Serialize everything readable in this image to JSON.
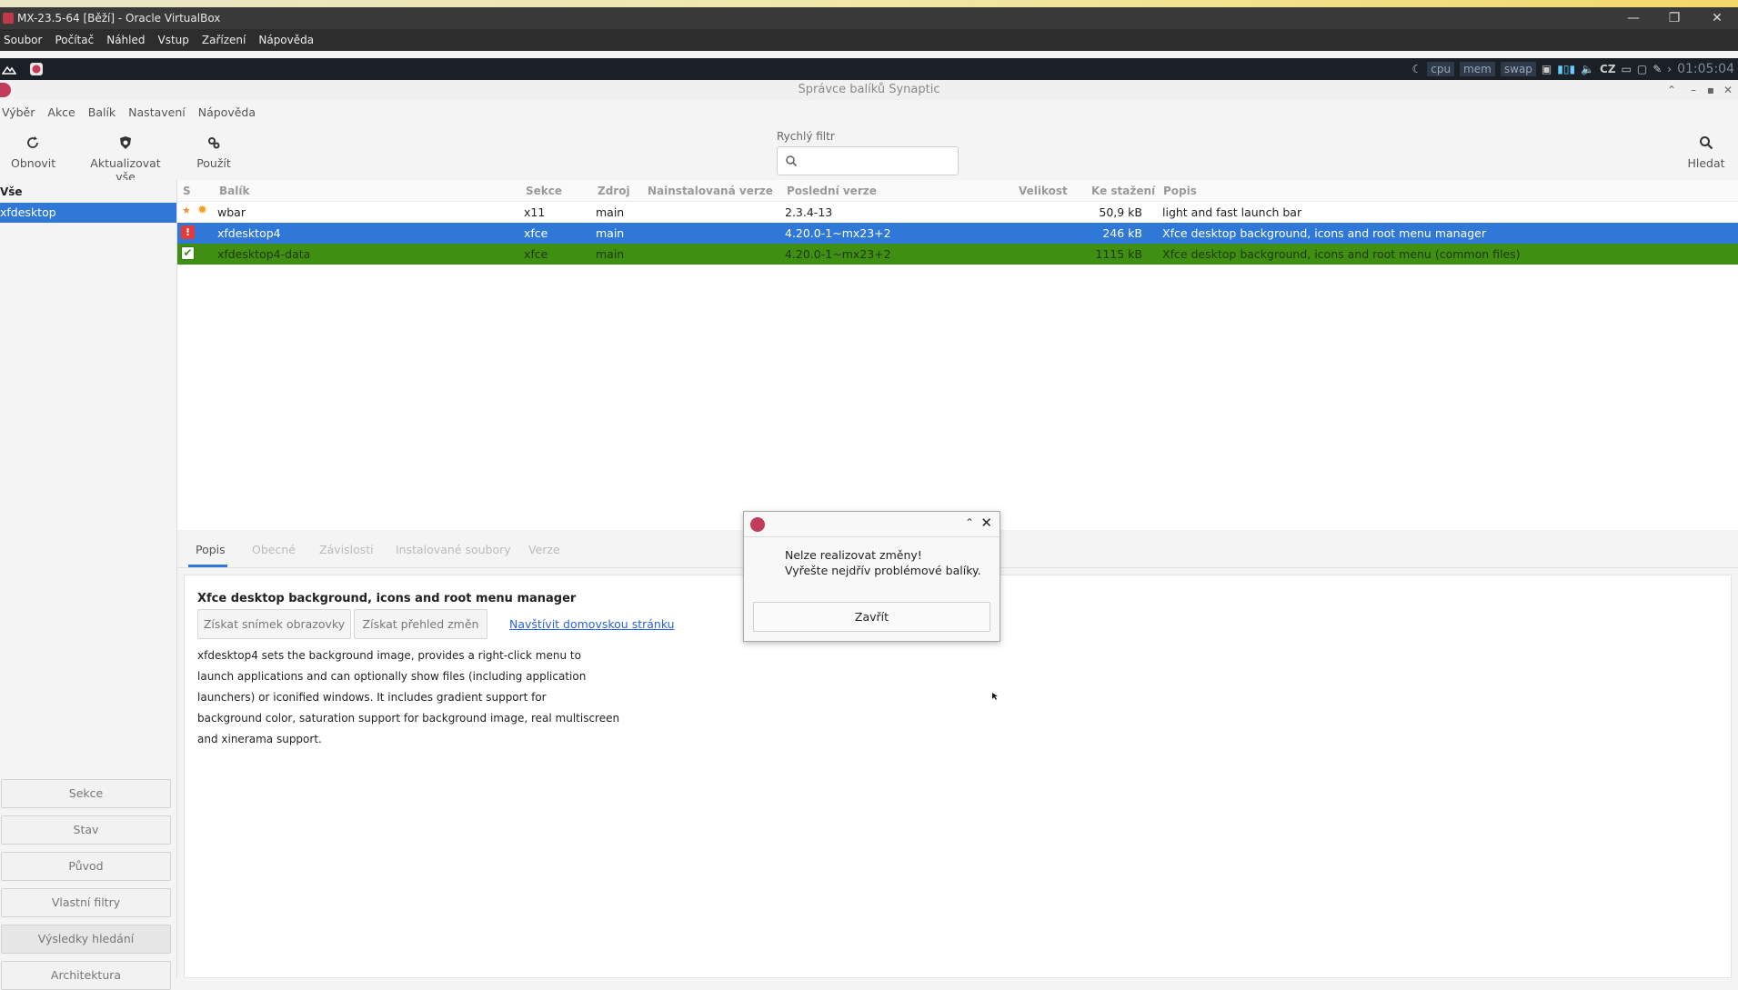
{
  "host": {
    "title": "MX-23.5-64 [Běží] - Oracle VirtualBox",
    "menu": [
      "Soubor",
      "Počítač",
      "Náhled",
      "Vstup",
      "Zařízení",
      "Nápověda"
    ],
    "minimize": "—",
    "maximize": "❐",
    "close": "✕"
  },
  "panel": {
    "cpu": "cpu",
    "mem": "mem",
    "swap": "swap",
    "keyboard": "CZ",
    "clock": "01:05:04"
  },
  "synaptic": {
    "title": "Správce balíků Synaptic",
    "menu": [
      "Výběr",
      "Akce",
      "Balík",
      "Nastavení",
      "Nápověda"
    ],
    "toolbar": {
      "reload": "Obnovit",
      "upgrade_all": "Aktualizovat vše",
      "apply": "Použít",
      "search": "Hledat"
    },
    "quick_filter": {
      "label": "Rychlý filtr",
      "value": ""
    },
    "sidebar": {
      "header": "Vše",
      "selected": "xfdesktop",
      "buttons": [
        "Sekce",
        "Stav",
        "Původ",
        "Vlastní filtry",
        "Výsledky hledání",
        "Architektura"
      ]
    },
    "columns": [
      "S",
      "Balík",
      "Sekce",
      "Zdroj",
      "Nainstalovaná verze",
      "Poslední verze",
      "Velikost",
      "Ke stažení",
      "Popis"
    ],
    "packages": [
      {
        "name": "wbar",
        "section": "x11",
        "source": "main",
        "installed": "",
        "latest": "2.3.4-13",
        "size": "",
        "download": "50,9 kB",
        "desc": "light and fast launch bar"
      },
      {
        "name": "xfdesktop4",
        "section": "xfce",
        "source": "main",
        "installed": "",
        "latest": "4.20.0-1~mx23+2",
        "size": "",
        "download": "246 kB",
        "desc": "Xfce desktop background, icons and root menu manager"
      },
      {
        "name": "xfdesktop4-data",
        "section": "xfce",
        "source": "main",
        "installed": "",
        "latest": "4.20.0-1~mx23+2",
        "size": "",
        "download": "1115 kB",
        "desc": "Xfce desktop background, icons and root menu (common files)"
      }
    ],
    "tabs": [
      "Popis",
      "Obecné",
      "Závislosti",
      "Instalované soubory",
      "Verze"
    ],
    "details": {
      "title": "Xfce desktop background, icons and root menu manager",
      "screenshot_btn": "Získat snímek obrazovky",
      "changelog_btn": "Získat přehled změn",
      "homepage_link": "Navštívit domovskou stránku",
      "description_lines": [
        "xfdesktop4 sets the background image, provides a right-click menu to",
        "launch applications and can optionally show files (including application",
        "launchers) or iconified windows. It includes gradient support for",
        "background color, saturation support for background image, real multiscreen",
        "and xinerama support."
      ]
    },
    "dialog": {
      "message1": "Nelze realizovat změny!",
      "message2": "Vyřešte nejdřív problémové balíky.",
      "close_button": "Zavřít"
    }
  }
}
